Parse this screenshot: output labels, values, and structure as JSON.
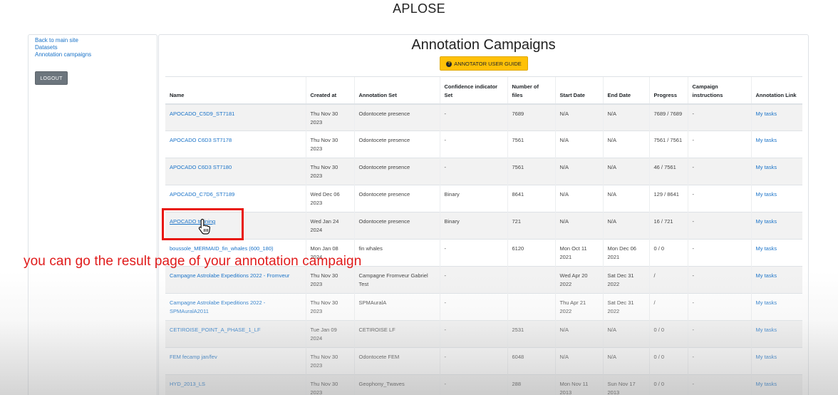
{
  "app": {
    "title": "APLOSE"
  },
  "sidebar": {
    "links": [
      "Back to main site",
      "Datasets",
      "Annotation campaigns"
    ],
    "logout_label": "LOGOUT"
  },
  "main": {
    "title": "Annotation Campaigns",
    "guide_button": "ANNOTATOR USER GUIDE"
  },
  "table": {
    "headers": [
      "Name",
      "Created at",
      "Annotation Set",
      "Confidence indicator Set",
      "Number of files",
      "Start Date",
      "End Date",
      "Progress",
      "Campaign instructions",
      "Annotation Link"
    ],
    "rows": [
      {
        "name": "APOCADO_C5D9_ST7181",
        "created": "Thu Nov 30 2023",
        "annotation_set": "Odontocete presence",
        "confidence": "-",
        "files": "7689",
        "start": "N/A",
        "end": "N/A",
        "progress": "7689 / 7689",
        "instructions": "-",
        "link": "My tasks"
      },
      {
        "name": "APOCADO C6D3 ST7178",
        "created": "Thu Nov 30 2023",
        "annotation_set": "Odontocete presence",
        "confidence": "-",
        "files": "7561",
        "start": "N/A",
        "end": "N/A",
        "progress": "7561 / 7561",
        "instructions": "-",
        "link": "My tasks"
      },
      {
        "name": "APOCADO C6D3 ST7180",
        "created": "Thu Nov 30 2023",
        "annotation_set": "Odontocete presence",
        "confidence": "-",
        "files": "7561",
        "start": "N/A",
        "end": "N/A",
        "progress": "46 / 7561",
        "instructions": "-",
        "link": "My tasks"
      },
      {
        "name": "APOCADO_C7D6_ST7189",
        "created": "Wed Dec 06 2023",
        "annotation_set": "Odontocete presence",
        "confidence": "Binary",
        "files": "8641",
        "start": "N/A",
        "end": "N/A",
        "progress": "129 / 8641",
        "instructions": "-",
        "link": "My tasks"
      },
      {
        "name": "APOCADO training",
        "created": "Wed Jan 24 2024",
        "annotation_set": "Odontocete presence",
        "confidence": "Binary",
        "files": "721",
        "start": "N/A",
        "end": "N/A",
        "progress": "16 / 721",
        "instructions": "-",
        "link": "My tasks"
      },
      {
        "name": "boussole_MERMAID_fin_whales (600_180)",
        "created": "Mon Jan 08 2024",
        "annotation_set": "fin whales",
        "confidence": "-",
        "files": "6120",
        "start": "Mon Oct 11 2021",
        "end": "Mon Dec 06 2021",
        "progress": "0 / 0",
        "instructions": "-",
        "link": "My tasks"
      },
      {
        "name": "Campagne Astrolabe Expeditions 2022 - Fromveur",
        "created": "Thu Nov 30 2023",
        "annotation_set": "Campagne Fromveur Gabriel Test",
        "confidence": "-",
        "files": "",
        "start": "Wed Apr 20 2022",
        "end": "Sat Dec 31 2022",
        "progress": "/",
        "instructions": "-",
        "link": "My tasks"
      },
      {
        "name": "Campagne Astrolabe Expeditions 2022 - SPMAuralA2011",
        "created": "Thu Nov 30 2023",
        "annotation_set": "SPMAuralA",
        "confidence": "-",
        "files": "",
        "start": "Thu Apr 21 2022",
        "end": "Sat Dec 31 2022",
        "progress": "/",
        "instructions": "-",
        "link": "My tasks"
      },
      {
        "name": "CETIROISE_POINT_A_PHASE_1_LF",
        "created": "Tue Jan 09 2024",
        "annotation_set": "CETIROISE LF",
        "confidence": "-",
        "files": "2531",
        "start": "N/A",
        "end": "N/A",
        "progress": "0 / 0",
        "instructions": "-",
        "link": "My tasks"
      },
      {
        "name": "FEM fecamp jan/fev",
        "created": "Thu Nov 30 2023",
        "annotation_set": "Odontocete FEM",
        "confidence": "-",
        "files": "6048",
        "start": "N/A",
        "end": "N/A",
        "progress": "0 / 0",
        "instructions": "-",
        "link": "My tasks"
      },
      {
        "name": "HYD_2013_LS",
        "created": "Thu Nov 30 2023",
        "annotation_set": "Geophony_Twaves",
        "confidence": "-",
        "files": "288",
        "start": "Mon Nov 11 2013",
        "end": "Sun Nov 17 2013",
        "progress": "0 / 0",
        "instructions": "-",
        "link": "My tasks"
      }
    ]
  },
  "overlay": {
    "caption": "you can go the result page of your annotation campaign"
  },
  "colors": {
    "accent_yellow": "#ffc107",
    "link_blue": "#1a73c8",
    "highlight_red": "#e8160d",
    "caption_red": "#e01b1b"
  }
}
